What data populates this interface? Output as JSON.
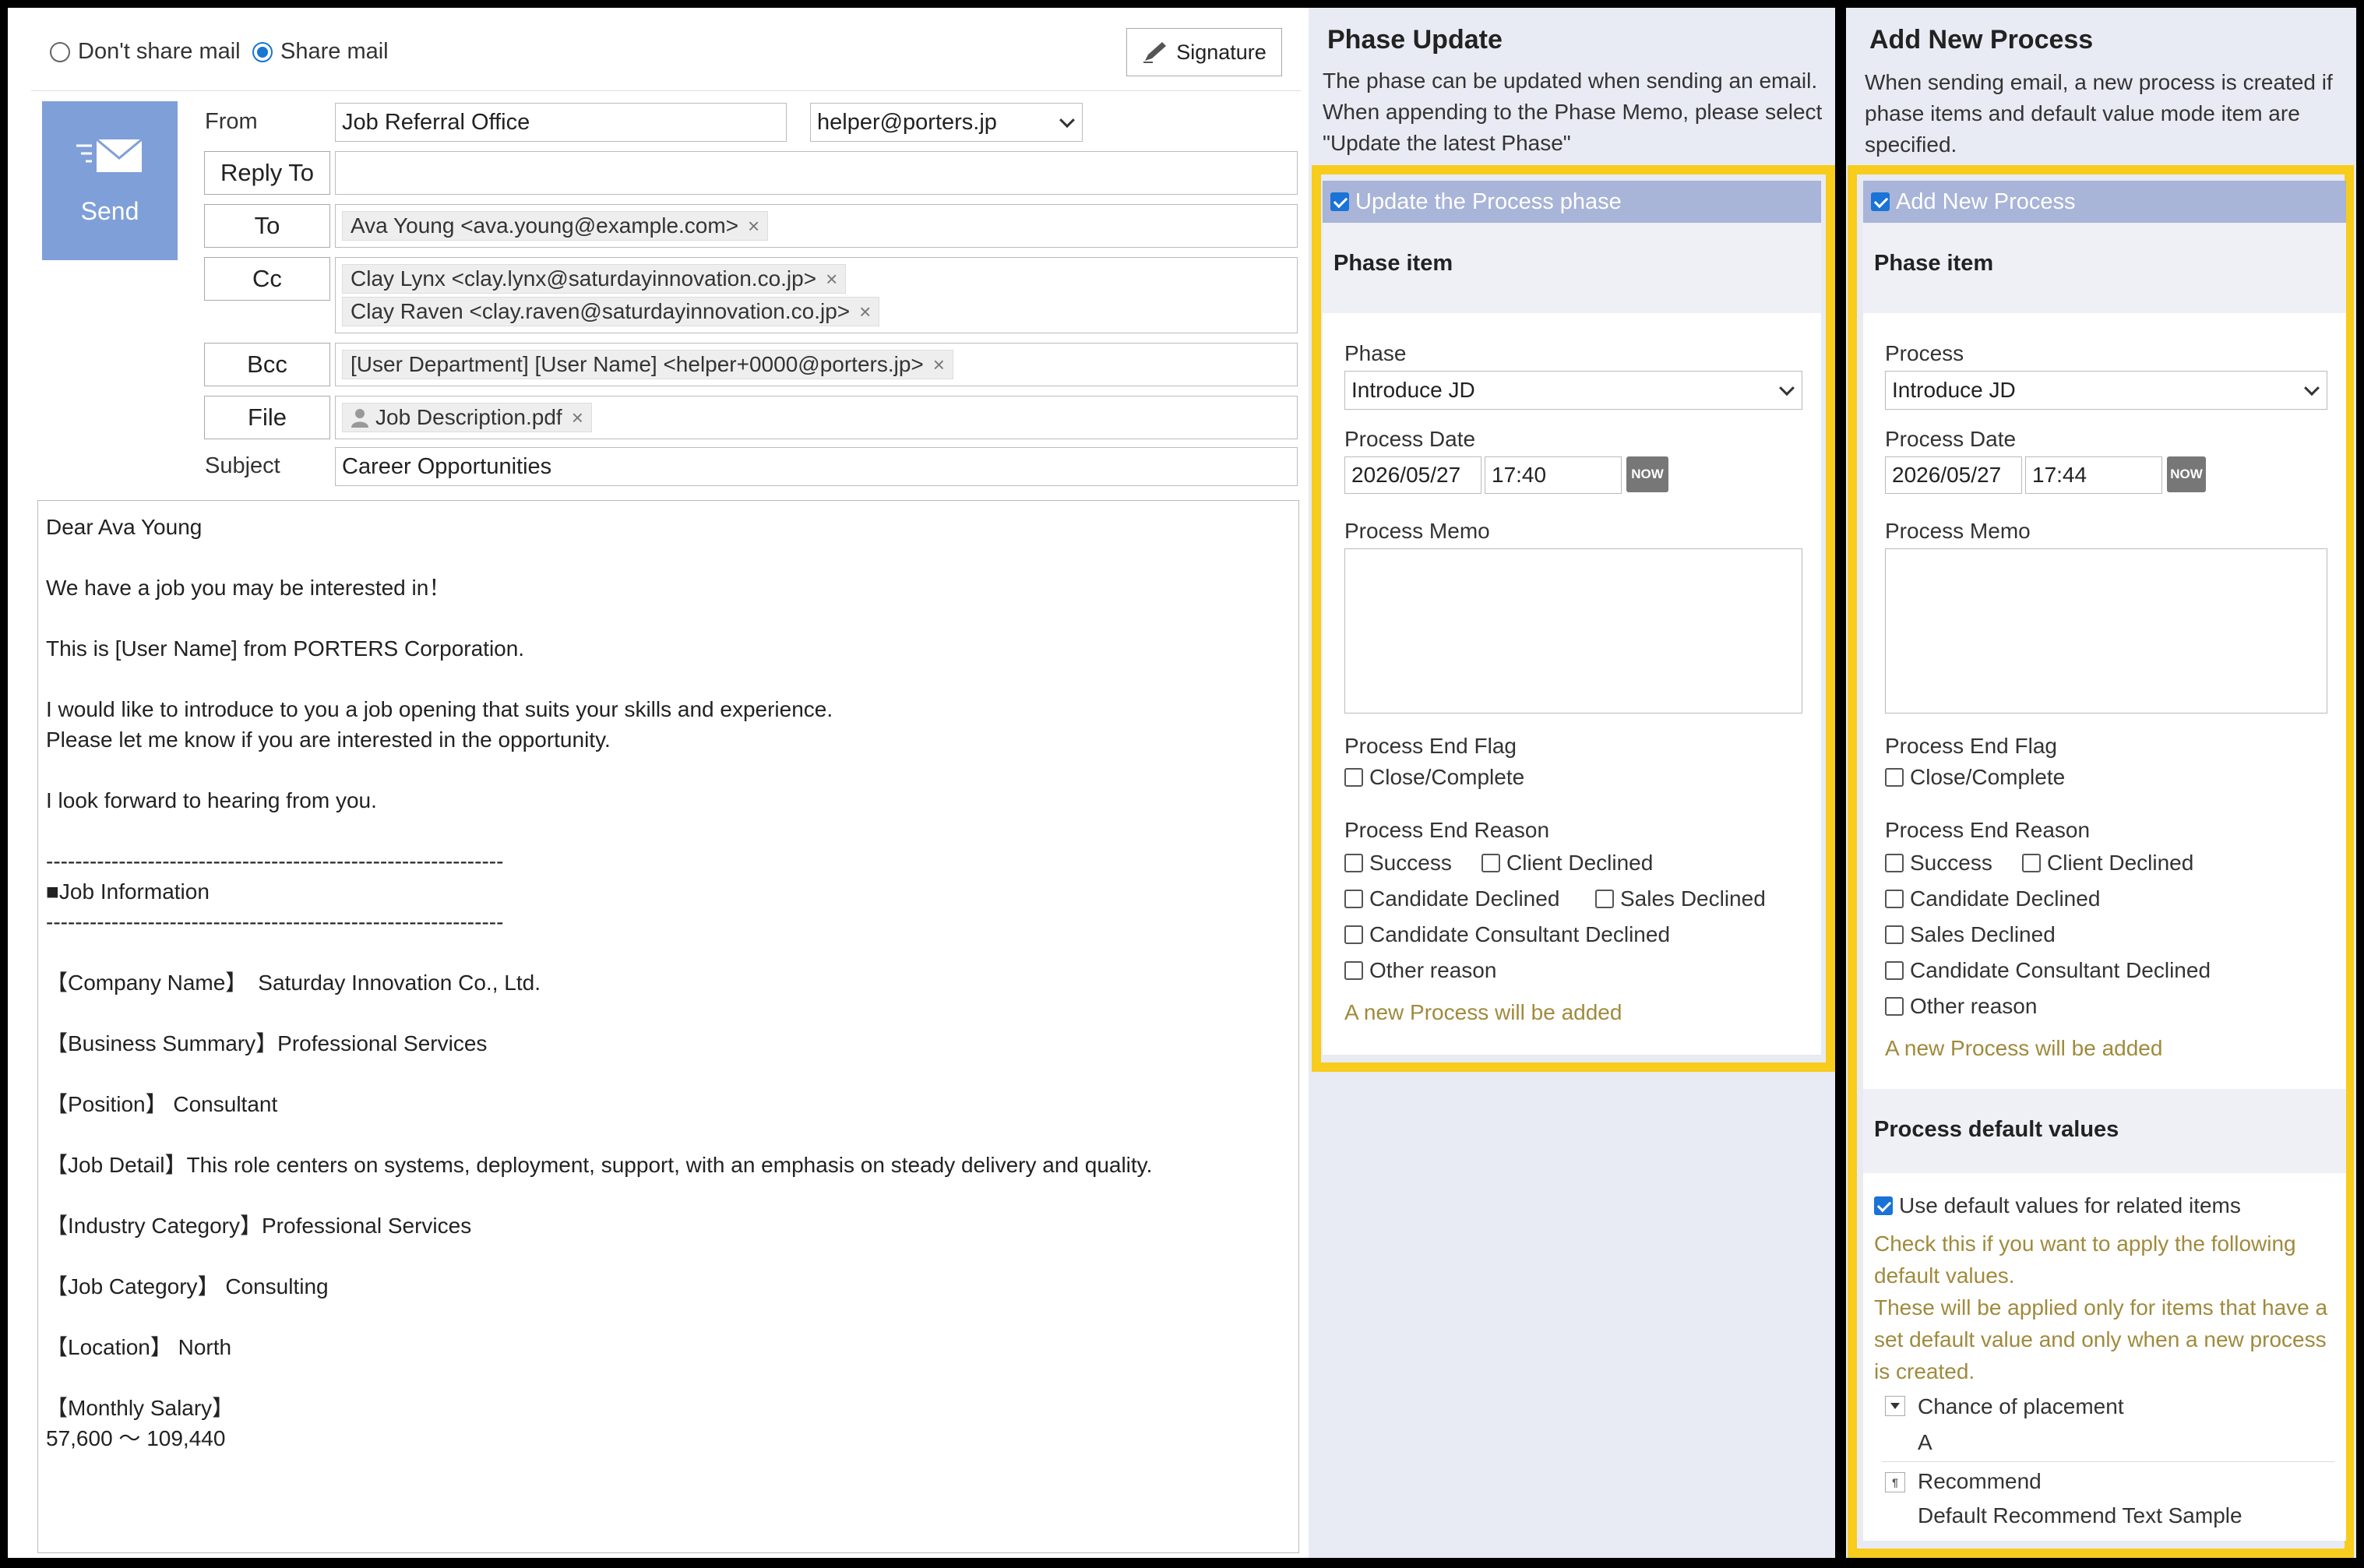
{
  "compose": {
    "share_options": [
      "Don't share mail",
      "Share mail"
    ],
    "share_selected": "Share mail",
    "signature_label": "Signature",
    "send_label": "Send",
    "from_label": "From",
    "from_name": "Job Referral Office",
    "from_address": "helper@porters.jp",
    "reply_to_label": "Reply To",
    "to_label": "To",
    "to_recipients": [
      "Ava Young <ava.young@example.com>"
    ],
    "cc_label": "Cc",
    "cc_recipients": [
      "Clay Lynx <clay.lynx@saturdayinnovation.co.jp>",
      "Clay Raven <clay.raven@saturdayinnovation.co.jp>"
    ],
    "bcc_label": "Bcc",
    "bcc_recipients": [
      "[User Department] [User Name] <helper+0000@porters.jp>"
    ],
    "file_label": "File",
    "files": [
      "Job Description.pdf"
    ],
    "subject_label": "Subject",
    "subject": "Career Opportunities",
    "body_lines": [
      "Dear Ava Young",
      "",
      "We have a job you may be interested in！",
      "",
      "This is [User Name] from PORTERS Corporation.",
      "",
      "I would like to introduce to you a job opening that suits your skills and experience.",
      "Please let me know if you are interested in the opportunity.",
      "",
      "I look forward to hearing from you.",
      "",
      "---------------------------------------------------------------",
      "■Job Information",
      "---------------------------------------------------------------",
      "",
      "【Company Name】　Saturday Innovation Co., Ltd.",
      "",
      "【Business Summary】Professional Services",
      "",
      "【Position】 Consultant",
      "",
      "【Job Detail】This role centers on systems, deployment, support, with an emphasis on steady delivery and quality.",
      "",
      "【Industry Category】Professional Services",
      "",
      "【Job Category】 Consulting",
      "",
      "【Location】 North",
      "",
      "【Monthly Salary】",
      "57,600 ～ 109,440"
    ]
  },
  "phase_update": {
    "title": "Phase Update",
    "description": "The phase can be updated when sending an email. When appending to the Phase Memo, please select \"Update the latest Phase\"",
    "toggle_label": "Update the Process phase",
    "toggle_checked": true,
    "section_label": "Phase item",
    "phase_label": "Phase",
    "phase_value": "Introduce JD",
    "date_label": "Process Date",
    "date_value": "2026/05/27",
    "time_value": "17:40",
    "now_label": "NOW",
    "memo_label": "Process Memo",
    "memo_value": "",
    "end_flag_label": "Process End Flag",
    "end_flag_option": "Close/Complete",
    "end_reason_label": "Process End Reason",
    "end_reasons": [
      "Success",
      "Client Declined",
      "Candidate Declined",
      "Sales Declined",
      "Candidate Consultant Declined",
      "Other reason"
    ],
    "note": "A new Process will be added"
  },
  "add_process": {
    "title": "Add New Process",
    "description": "When sending email, a new process is created if phase items and default value mode item are specified.",
    "toggle_label": "Add New Process",
    "toggle_checked": true,
    "section_label": "Phase item",
    "process_label": "Process",
    "process_value": "Introduce JD",
    "date_label": "Process Date",
    "date_value": "2026/05/27",
    "time_value": "17:44",
    "now_label": "NOW",
    "memo_label": "Process Memo",
    "memo_value": "",
    "end_flag_label": "Process End Flag",
    "end_flag_option": "Close/Complete",
    "end_reason_label": "Process End Reason",
    "end_reasons": [
      "Success",
      "Client Declined",
      "Candidate Declined",
      "Sales Declined",
      "Candidate Consultant Declined",
      "Other reason"
    ],
    "note": "A new Process will be added",
    "defaults_label": "Process default values",
    "use_defaults_label": "Use default values for related items",
    "use_defaults_checked": true,
    "defaults_help": "Check this if you want to apply the following default values.\nThese will be applied only for items that have a set default value and only when a new process is created.",
    "default_items": [
      {
        "label": "Chance of placement",
        "value": "A",
        "icon": "dropdown-icon"
      },
      {
        "label": "Recommend",
        "value": "Default Recommend Text Sample",
        "icon": "text-icon"
      }
    ]
  },
  "colors": {
    "accent": "#1976d2",
    "send_button": "#7f9fd9",
    "highlight_frame": "#f7cc1d",
    "panel_bg": "#e8ebf3",
    "toggle_bar": "#a8b4d8",
    "note_text": "#a08a3c"
  }
}
